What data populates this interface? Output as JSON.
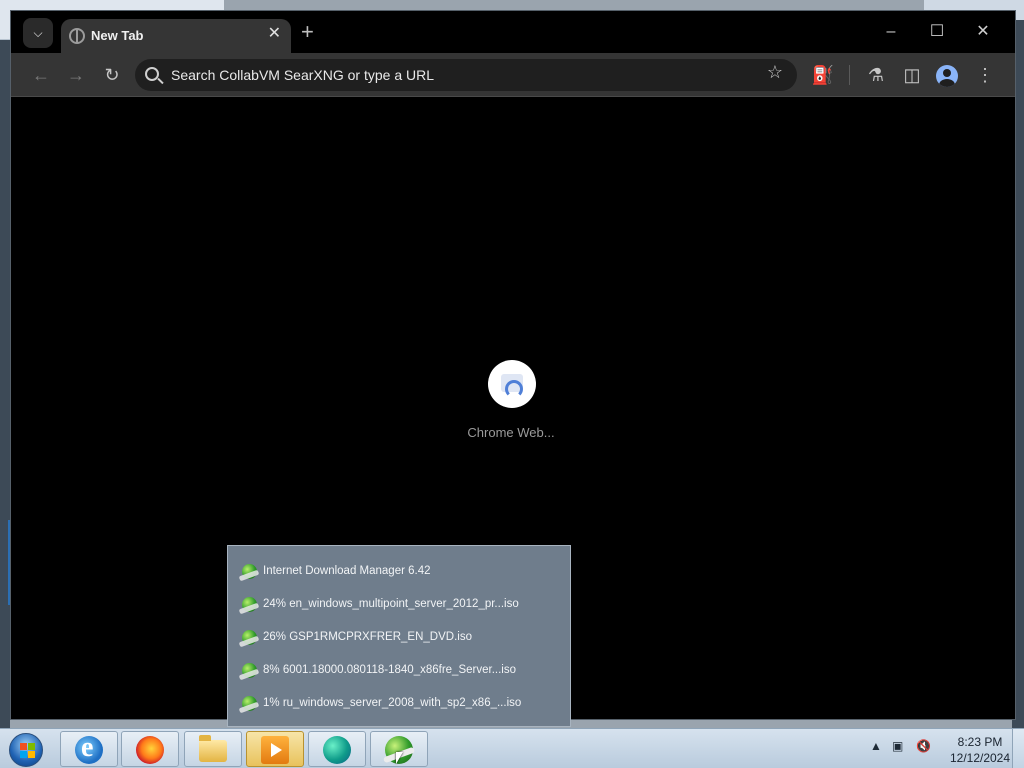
{
  "browser": {
    "tab": {
      "title": "New Tab"
    },
    "omnibox": {
      "placeholder": "Search CollabVM SearXNG or type a URL"
    },
    "loading_label": "Chrome Web..."
  },
  "idm_menu": {
    "items": [
      "Internet Download Manager 6.42",
      "24% en_windows_multipoint_server_2012_pr...iso",
      "26% GSP1RMCPRXFRER_EN_DVD.iso",
      "8% 6001.18000.080118-1840_x86fre_Server...iso",
      "1% ru_windows_server_2008_with_sp2_x86_...iso"
    ]
  },
  "taskbar": {
    "apps": [
      "internet-explorer",
      "firefox",
      "file-explorer",
      "media-center",
      "edge",
      "internet-download-manager"
    ],
    "clock": {
      "time": "8:23 PM",
      "date": "12/12/2024"
    }
  }
}
